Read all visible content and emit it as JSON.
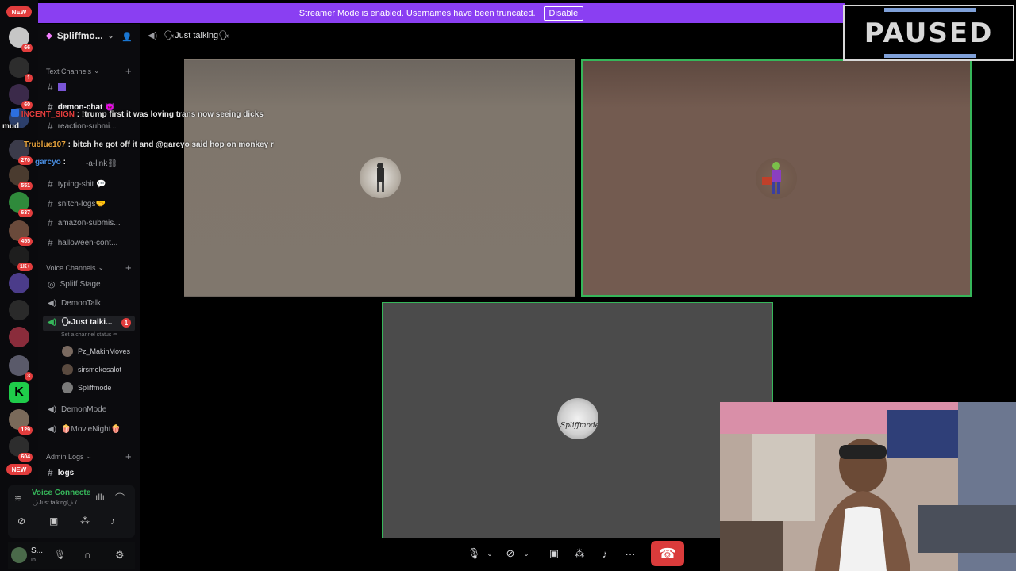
{
  "banner": {
    "text": "Streamer Mode is enabled. Usernames have been truncated.",
    "button": "Disable"
  },
  "guild": {
    "name": "Spliffmo..."
  },
  "topbar": {
    "channel": "🗣Just talking🗣"
  },
  "categories": {
    "text": "Text Channels",
    "voice": "Voice Channels",
    "admin": "Admin Logs"
  },
  "text_channels": [
    "demon-chat 😈",
    "reaction-submi...",
    "-a-link⛓",
    "typing-shit 💬",
    "snitch-logs🤝",
    "amazon-submis...",
    "halloween-cont..."
  ],
  "voice_channels": {
    "stage": "Spliff Stage",
    "demontalk": "DemonTalk",
    "active": "🗣Just talki...",
    "active_badge": "1",
    "active_status": "Set a channel status ✏",
    "demonmode": "DemonMode",
    "movienight": "🍿MovieNight🍿"
  },
  "members": [
    "Pz_MakinMoves",
    "sirsmokesalot",
    "Spliffmode"
  ],
  "admin_channels": [
    "logs"
  ],
  "voice_panel": {
    "title": "Voice Connecte",
    "subtitle": "🗣Just talking🗣 / ..."
  },
  "user_panel": {
    "name": "S...",
    "sub": "In"
  },
  "rail_badges": [
    "66",
    "1",
    "60",
    "270",
    "551",
    "637",
    "455",
    "1K+",
    "3",
    "129",
    "604"
  ],
  "rail_new": [
    "NEW",
    "NEW"
  ],
  "chat": [
    {
      "name": "INCENT_SIGN",
      "sep": " : ",
      "msg": "!trump first it was loving trans now seeing dicks",
      "color": "#e23d3d"
    },
    {
      "name": "Trublue107",
      "sep": " : ",
      "msg": "bitch he got off it and @garcyo said hop on monkey r",
      "color": "#e6a23c"
    },
    {
      "name": "garcyo",
      "sep": " : ",
      "msg": "",
      "color": "#4a8de0"
    }
  ],
  "chat_prefix": "mud",
  "tile3_label": "Spliffmode",
  "paused": "PAUSED",
  "colors": {
    "accent": "#8a3ff2",
    "speaking": "#36b65a",
    "danger": "#da3b3b"
  }
}
